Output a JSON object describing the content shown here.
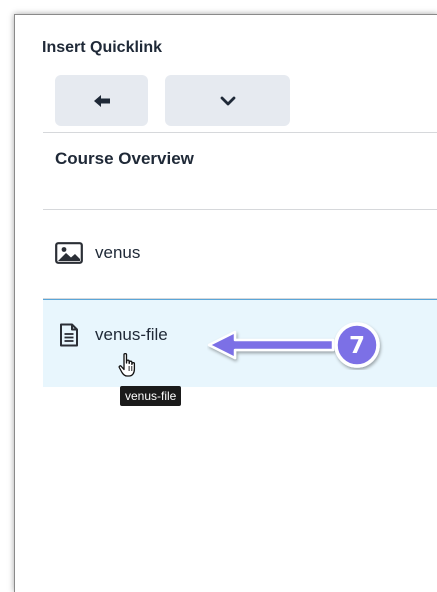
{
  "dialog": {
    "title": "Insert Quicklink"
  },
  "toolbar": {
    "back_icon": "arrow-left-icon",
    "more_icon": "chevron-down-icon"
  },
  "section": {
    "title": "Course Overview"
  },
  "items": [
    {
      "label": "venus",
      "icon": "image-icon",
      "selected": false
    },
    {
      "label": "venus-file",
      "icon": "document-icon",
      "selected": true
    }
  ],
  "tooltip": {
    "text": "venus-file"
  },
  "annotation": {
    "step": "7",
    "color": "#7b6fe6"
  },
  "colors": {
    "selected_row_bg": "#e8f6fd",
    "selected_row_border": "#5aa6d8",
    "toolbar_button_bg": "#e6eaf0"
  }
}
